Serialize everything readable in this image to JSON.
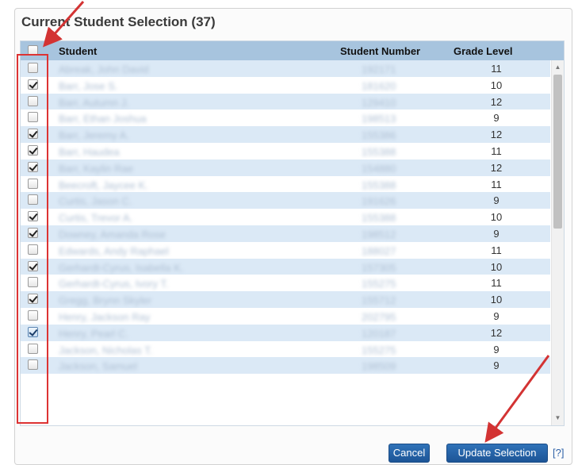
{
  "panel": {
    "title": "Current Student Selection (37)"
  },
  "grid": {
    "headers": {
      "student": "Student",
      "student_number": "Student Number",
      "grade_level": "Grade Level"
    },
    "select_all_checked": false,
    "rows": [
      {
        "name": "Abreak, John David",
        "number": "192171",
        "grade": "11",
        "checked": false
      },
      {
        "name": "Barr, Jose S.",
        "number": "181620",
        "grade": "10",
        "checked": true
      },
      {
        "name": "Barr, Autumn J.",
        "number": "129410",
        "grade": "12",
        "checked": false
      },
      {
        "name": "Barr, Ethan Joshua",
        "number": "198513",
        "grade": "9",
        "checked": false
      },
      {
        "name": "Barr, Jeremy A.",
        "number": "155386",
        "grade": "12",
        "checked": true
      },
      {
        "name": "Barr, Haudea",
        "number": "155388",
        "grade": "11",
        "checked": true
      },
      {
        "name": "Barr, Kaylin Rae",
        "number": "154880",
        "grade": "12",
        "checked": true
      },
      {
        "name": "Beecroft, Jaycee K.",
        "number": "155388",
        "grade": "11",
        "checked": false
      },
      {
        "name": "Curtis, Jason C.",
        "number": "191626",
        "grade": "9",
        "checked": false
      },
      {
        "name": "Curtis, Trevor A.",
        "number": "155388",
        "grade": "10",
        "checked": true
      },
      {
        "name": "Downey, Amanda Rose",
        "number": "198512",
        "grade": "9",
        "checked": true
      },
      {
        "name": "Edwards, Andy Raphael",
        "number": "188027",
        "grade": "11",
        "checked": false
      },
      {
        "name": "Gerhardt-Cyrus, Isabella K.",
        "number": "157305",
        "grade": "10",
        "checked": true
      },
      {
        "name": "Gerhardt-Cyrus, Ivory T.",
        "number": "155275",
        "grade": "11",
        "checked": false
      },
      {
        "name": "Gregg, Brynn Skyler",
        "number": "155712",
        "grade": "10",
        "checked": true
      },
      {
        "name": "Henry, Jackson Ray",
        "number": "202795",
        "grade": "9",
        "checked": false
      },
      {
        "name": "Henry, Pearl C.",
        "number": "120187",
        "grade": "12",
        "checked": true,
        "focused": true
      },
      {
        "name": "Jackson, Nicholas T.",
        "number": "155275",
        "grade": "9",
        "checked": false
      },
      {
        "name": "Jackson, Samuel",
        "number": "198509",
        "grade": "9",
        "checked": false
      }
    ]
  },
  "buttons": {
    "cancel": "Cancel",
    "update": "Update Selection",
    "help": "[?]"
  },
  "colors": {
    "header_bg": "#a7c4de",
    "row_alt_bg": "#dbe9f6",
    "button_bg": "#2463a8",
    "annotation": "#d33333"
  },
  "icons": {
    "scroll_up": "scroll-up-icon",
    "scroll_down": "scroll-down-icon",
    "checkbox": "checkbox-icon"
  }
}
